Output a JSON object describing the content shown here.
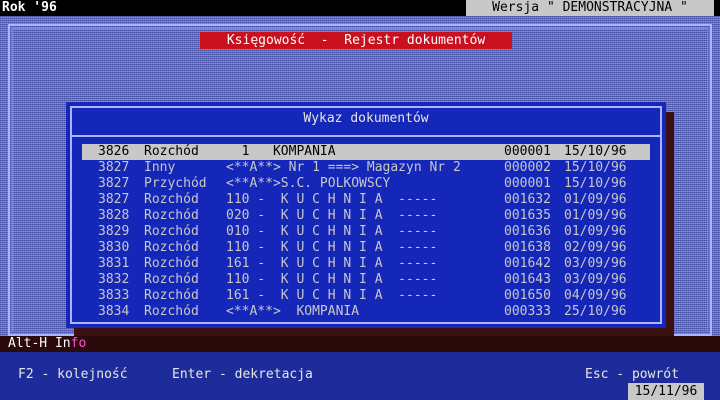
{
  "app": {
    "title": "Rok '96",
    "version": "Wersja \" DEMONSTRACYJNA \""
  },
  "module": {
    "title": "Księgowość  -  Rejestr dokumentów"
  },
  "dialog": {
    "title": "Wykaz dokumentów",
    "rows": [
      {
        "num": "3826",
        "type": "Rozchód",
        "desc": "  1   KOMPANIA",
        "doc": "000001",
        "date": "15/10/96",
        "selected": true
      },
      {
        "num": "3827",
        "type": "Inny",
        "desc": "<**A**> Nr 1 ===> Magazyn Nr 2",
        "doc": "000002",
        "date": "15/10/96",
        "selected": false
      },
      {
        "num": "3827",
        "type": "Przychód",
        "desc": "<**A**>S.C. POLKOWSCY",
        "doc": "000001",
        "date": "15/10/96",
        "selected": false
      },
      {
        "num": "3827",
        "type": "Rozchód",
        "desc": "110 -  K U C H N I A  -----",
        "doc": "001632",
        "date": "01/09/96",
        "selected": false
      },
      {
        "num": "3828",
        "type": "Rozchód",
        "desc": "020 -  K U C H N I A  -----",
        "doc": "001635",
        "date": "01/09/96",
        "selected": false
      },
      {
        "num": "3829",
        "type": "Rozchód",
        "desc": "010 -  K U C H N I A  -----",
        "doc": "001636",
        "date": "01/09/96",
        "selected": false
      },
      {
        "num": "3830",
        "type": "Rozchód",
        "desc": "110 -  K U C H N I A  -----",
        "doc": "001638",
        "date": "02/09/96",
        "selected": false
      },
      {
        "num": "3831",
        "type": "Rozchód",
        "desc": "161 -  K U C H N I A  -----",
        "doc": "001642",
        "date": "03/09/96",
        "selected": false
      },
      {
        "num": "3832",
        "type": "Rozchód",
        "desc": "110 -  K U C H N I A  -----",
        "doc": "001643",
        "date": "03/09/96",
        "selected": false
      },
      {
        "num": "3833",
        "type": "Rozchód",
        "desc": "161 -  K U C H N I A  -----",
        "doc": "001650",
        "date": "04/09/96",
        "selected": false
      },
      {
        "num": "3834",
        "type": "Rozchód",
        "desc": "<**A**>  KOMPANIA",
        "doc": "000333",
        "date": "25/10/96",
        "selected": false
      }
    ]
  },
  "hint": {
    "prefix": "Alt-H In",
    "suffix": "fo"
  },
  "status": {
    "f2": "F2 - kolejność",
    "enter": "Enter - dekretacja",
    "esc": "Esc - powrót",
    "date": "15/11/96"
  },
  "colors": {
    "desktop": "#5563c9",
    "dialog": "#1427b8",
    "module_title_bg": "#c8101e",
    "selection": "#c8c8c8"
  }
}
